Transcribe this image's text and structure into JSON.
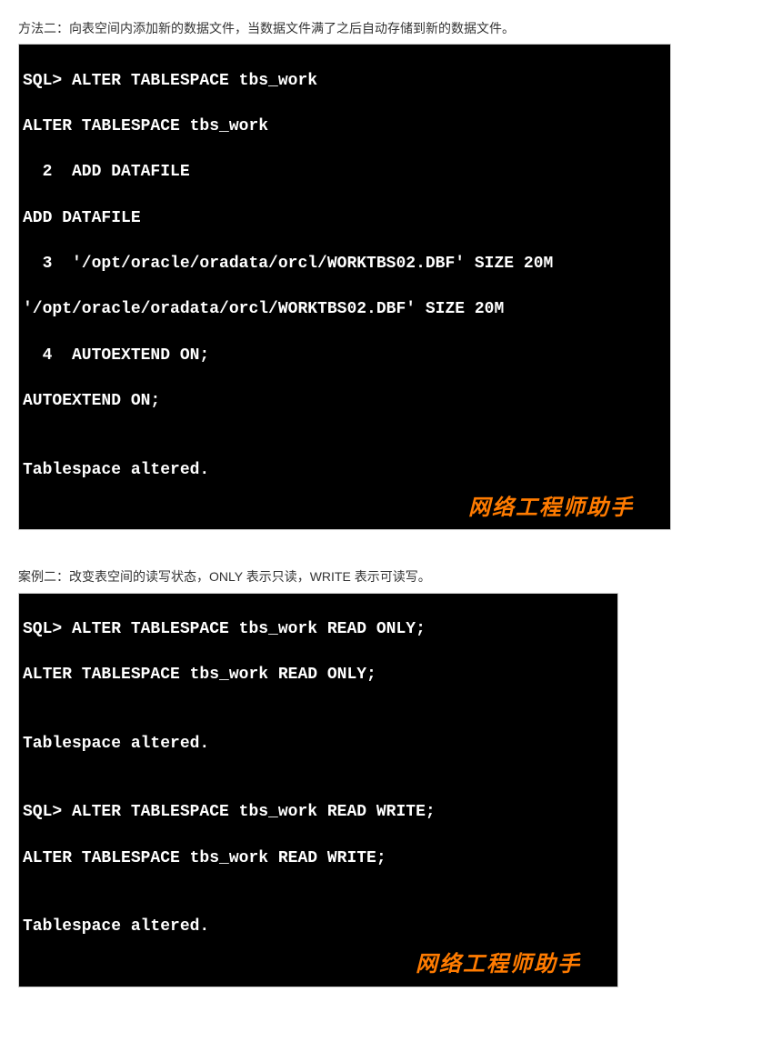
{
  "section1": {
    "caption": "方法二：向表空间内添加新的数据文件，当数据文件满了之后自动存储到新的数据文件。",
    "lines": {
      "l0": "SQL> ALTER TABLESPACE tbs_work",
      "l1": "ALTER TABLESPACE tbs_work",
      "l2": "  2  ADD DATAFILE",
      "l3": "ADD DATAFILE",
      "l4": "  3  '/opt/oracle/oradata/orcl/WORKTBS02.DBF' SIZE 20M",
      "l5": "'/opt/oracle/oradata/orcl/WORKTBS02.DBF' SIZE 20M",
      "l6": "  4  AUTOEXTEND ON;",
      "l7": "AUTOEXTEND ON;",
      "l8": "",
      "l9": "Tablespace altered."
    },
    "watermark": "网络工程师助手"
  },
  "section2": {
    "caption": "案例二：改变表空间的读写状态，ONLY 表示只读，WRITE 表示可读写。",
    "lines": {
      "l0": "SQL> ALTER TABLESPACE tbs_work READ ONLY;",
      "l1": "ALTER TABLESPACE tbs_work READ ONLY;",
      "l2": "",
      "l3": "Tablespace altered.",
      "l4": "",
      "l5": "SQL> ALTER TABLESPACE tbs_work READ WRITE;",
      "l6": "ALTER TABLESPACE tbs_work READ WRITE;",
      "l7": "",
      "l8": "Tablespace altered."
    },
    "watermark": "网络工程师助手"
  }
}
